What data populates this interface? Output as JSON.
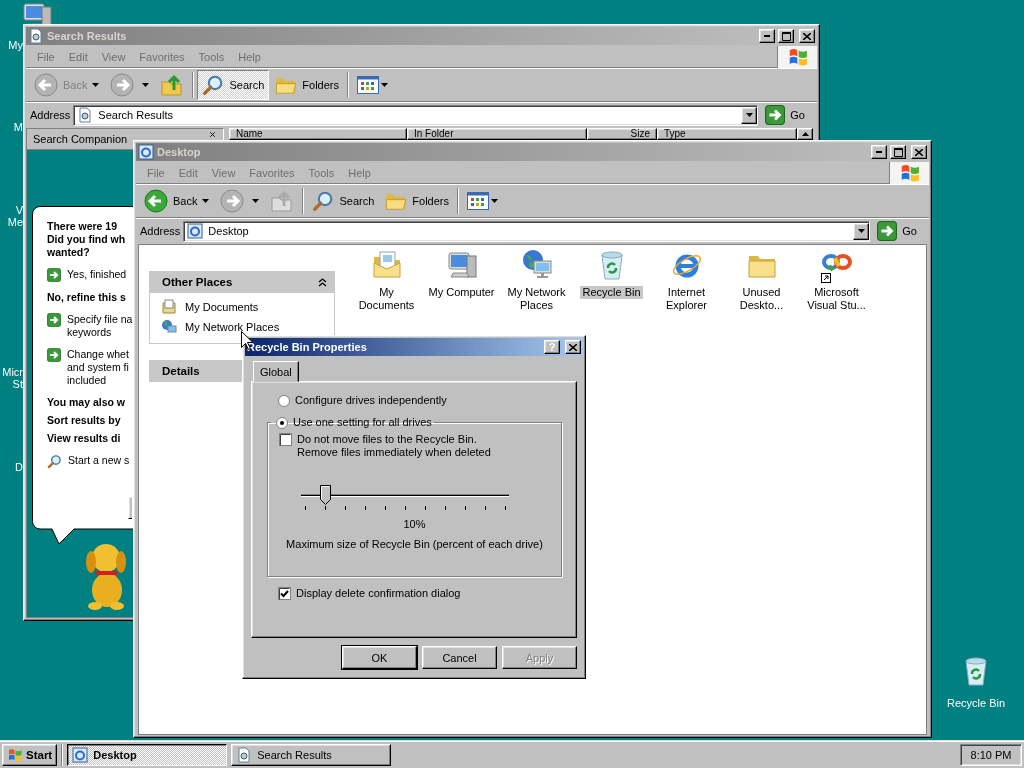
{
  "desktop": {
    "icon_labels": [
      {
        "label": "My"
      },
      {
        "label": "M"
      },
      {
        "label": "V\nMe"
      },
      {
        "label": "Micr\nSt"
      },
      {
        "label": "D"
      }
    ],
    "recycle_bin": {
      "label": "Recycle Bin"
    }
  },
  "search_window": {
    "title": "Search Results",
    "active": false,
    "menu": [
      "File",
      "Edit",
      "View",
      "Favorites",
      "Tools",
      "Help"
    ],
    "toolbar": [
      {
        "kind": "back",
        "label": "Back",
        "disabled": true
      },
      {
        "kind": "forward",
        "disabled": true
      },
      {
        "kind": "up",
        "disabled": false
      },
      {
        "kind": "search",
        "label": "Search",
        "pressed": true
      },
      {
        "kind": "folders",
        "label": "Folders",
        "pressed": false
      },
      {
        "kind": "views"
      }
    ],
    "address": {
      "label": "Address",
      "value": "Search Results",
      "go": "Go"
    },
    "companion": {
      "title": "Search Companion",
      "balloon": [
        {
          "kind": "heading",
          "text": "There were 19\nDid you find wh\nwanted?"
        },
        {
          "kind": "link",
          "text": "Yes, finished"
        },
        {
          "kind": "heading",
          "text": "No, refine this s"
        },
        {
          "kind": "link",
          "text": "Specify file na\nkeywords"
        },
        {
          "kind": "link",
          "text": "Change whet\nand system fi\nincluded"
        },
        {
          "kind": "heading",
          "text": "You may also w"
        },
        {
          "kind": "bold-link",
          "text": "Sort results by"
        },
        {
          "kind": "bold-link",
          "text": "View results di"
        },
        {
          "kind": "search",
          "text": "Start a new s"
        }
      ]
    },
    "columns": [
      "Name",
      "In Folder",
      "Size",
      "Type"
    ]
  },
  "desktop_window": {
    "title": "Desktop",
    "active": false,
    "menu": [
      "File",
      "Edit",
      "View",
      "Favorites",
      "Tools",
      "Help"
    ],
    "toolbar": [
      {
        "kind": "back",
        "label": "Back",
        "disabled": false
      },
      {
        "kind": "forward",
        "disabled": true
      },
      {
        "kind": "up",
        "disabled": true
      },
      {
        "kind": "search",
        "label": "Search",
        "pressed": false
      },
      {
        "kind": "folders",
        "label": "Folders",
        "pressed": false
      },
      {
        "kind": "views"
      }
    ],
    "address": {
      "label": "Address",
      "value": "Desktop",
      "go": "Go"
    },
    "task_panes": [
      {
        "title": "Other Places",
        "expanded": true,
        "items": [
          {
            "kind": "documents",
            "label": "My Documents"
          },
          {
            "kind": "network",
            "label": "My Network Places"
          }
        ]
      },
      {
        "title": "Details",
        "expanded": false
      }
    ],
    "icons": [
      {
        "kind": "documents",
        "label": "My Documents",
        "selected": false,
        "shortcut": false
      },
      {
        "kind": "computer",
        "label": "My Computer",
        "selected": false,
        "shortcut": false
      },
      {
        "kind": "network",
        "label": "My Network Places",
        "selected": false,
        "shortcut": false
      },
      {
        "kind": "recycle",
        "label": "Recycle Bin",
        "selected": true,
        "shortcut": false
      },
      {
        "kind": "ie",
        "label": "Internet Explorer",
        "selected": false,
        "shortcut": false
      },
      {
        "kind": "folder",
        "label": "Unused Deskto...",
        "selected": false,
        "shortcut": false
      },
      {
        "kind": "vstudio",
        "label": "Microsoft Visual Stu...",
        "selected": false,
        "shortcut": true
      }
    ]
  },
  "dialog": {
    "title": "Recycle Bin Properties",
    "active": true,
    "help": "?",
    "tabs": [
      {
        "label": "Global",
        "selected": true
      }
    ],
    "radios": [
      {
        "label": "Configure drives independently",
        "selected": false
      },
      {
        "label": "Use one setting for all drives",
        "selected": true
      }
    ],
    "delete_option": {
      "label": "Do not move files to the Recycle Bin.\nRemove files immediately when deleted",
      "checked": false
    },
    "slider": {
      "level": 0.1,
      "reading": "10%",
      "caption": "Maximum size of Recycle Bin (percent of each drive)"
    },
    "confirm_option": {
      "label": "Display delete confirmation dialog",
      "checked": true
    },
    "buttons": [
      {
        "label": "OK",
        "disabled": false,
        "default": true
      },
      {
        "label": "Cancel",
        "disabled": false,
        "default": false
      },
      {
        "label": "Apply",
        "disabled": true,
        "default": false
      }
    ]
  },
  "taskbar": {
    "start": "Start",
    "tasks": [
      {
        "kind": "explorer",
        "label": "Desktop",
        "selected": true
      },
      {
        "kind": "search",
        "label": "Search Results",
        "selected": false
      }
    ],
    "clock": "8:10 PM"
  }
}
